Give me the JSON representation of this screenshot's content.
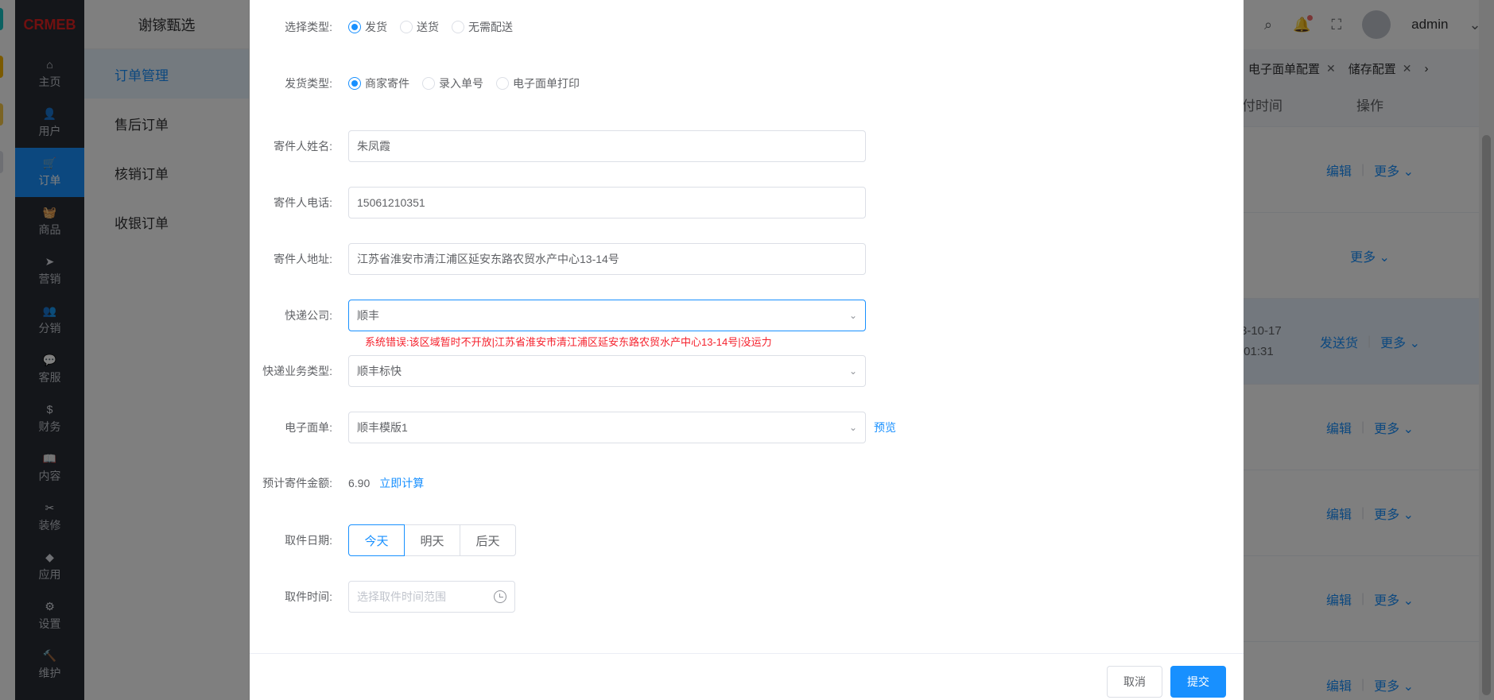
{
  "sidebar": {
    "logo": "CRMEB",
    "items": [
      {
        "label": "主页",
        "icon": "home-icon",
        "glyph": "⌂"
      },
      {
        "label": "用户",
        "icon": "user-icon",
        "glyph": "👤"
      },
      {
        "label": "订单",
        "icon": "cart-icon",
        "glyph": "🛒"
      },
      {
        "label": "商品",
        "icon": "basket-icon",
        "glyph": "🧺"
      },
      {
        "label": "营销",
        "icon": "send-icon",
        "glyph": "➤"
      },
      {
        "label": "分销",
        "icon": "group-icon",
        "glyph": "👥"
      },
      {
        "label": "客服",
        "icon": "chat-icon",
        "glyph": "💬"
      },
      {
        "label": "财务",
        "icon": "dollar-icon",
        "glyph": "$"
      },
      {
        "label": "内容",
        "icon": "book-icon",
        "glyph": "📖"
      },
      {
        "label": "装修",
        "icon": "tools-icon",
        "glyph": "✂"
      },
      {
        "label": "应用",
        "icon": "cube-icon",
        "glyph": "◆"
      },
      {
        "label": "设置",
        "icon": "gear-icon",
        "glyph": "⚙"
      },
      {
        "label": "维护",
        "icon": "hammer-icon",
        "glyph": "🔨"
      }
    ]
  },
  "submenu": {
    "title": "谢镓甄选",
    "items": [
      "订单管理",
      "售后订单",
      "核销订单",
      "收银订单"
    ]
  },
  "topbar": {
    "username": "admin"
  },
  "tabs": [
    {
      "label": "电子面单配置"
    },
    {
      "label": "储存配置"
    }
  ],
  "bg_table": {
    "headers": [
      "付时间",
      "操作"
    ],
    "rows": [
      {
        "time": "",
        "actions": [
          "编辑",
          "更多 ⌄"
        ]
      },
      {
        "time": "",
        "actions": [
          "更多 ⌄"
        ]
      },
      {
        "time": "3-10-17\n:01:31",
        "actions": [
          "发送货",
          "更多 ⌄"
        ]
      },
      {
        "time": "",
        "actions": [
          "编辑",
          "更多 ⌄"
        ]
      },
      {
        "time": "",
        "actions": [
          "编辑",
          "更多 ⌄"
        ]
      },
      {
        "time": "",
        "actions": [
          "编辑",
          "更多 ⌄"
        ]
      },
      {
        "time": "",
        "actions": [
          "编辑",
          "更多 ⌄"
        ]
      }
    ]
  },
  "form": {
    "select_type": {
      "label": "选择类型:",
      "options": [
        "发货",
        "送货",
        "无需配送"
      ],
      "selected": 0
    },
    "ship_type": {
      "label": "发货类型:",
      "options": [
        "商家寄件",
        "录入单号",
        "电子面单打印"
      ],
      "selected": 0
    },
    "sender_name": {
      "label": "寄件人姓名:",
      "value": "朱凤霞"
    },
    "sender_phone": {
      "label": "寄件人电话:",
      "value": "15061210351"
    },
    "sender_address": {
      "label": "寄件人地址:",
      "value": "江苏省淮安市清江浦区延安东路农贸水产中心13-14号"
    },
    "express_company": {
      "label": "快递公司:",
      "value": "顺丰"
    },
    "error_text": "系统错误:该区域暂时不开放|江苏省淮安市清江浦区延安东路农贸水产中心13-14号|没运力",
    "service_type": {
      "label": "快递业务类型:",
      "value": "顺丰标快"
    },
    "e_waybill": {
      "label": "电子面单:",
      "value": "顺丰模版1",
      "preview": "预览"
    },
    "est_fee": {
      "label": "预计寄件金额:",
      "value": "6.90",
      "calc": "立即计算"
    },
    "pickup_date": {
      "label": "取件日期:",
      "options": [
        "今天",
        "明天",
        "后天"
      ],
      "selected": 0
    },
    "pickup_time": {
      "label": "取件时间:",
      "placeholder": "选择取件时间范围"
    }
  },
  "footer": {
    "cancel": "取消",
    "submit": "提交"
  },
  "colors": {
    "primary": "#1890ff",
    "sidebar_bg": "#282c34",
    "error": "#f5222d"
  }
}
